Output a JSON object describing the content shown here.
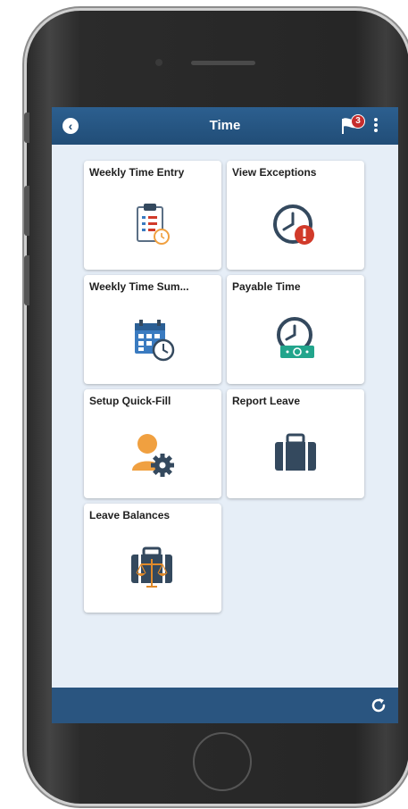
{
  "header": {
    "title": "Time",
    "notification_count": "3"
  },
  "tiles": [
    {
      "label": "Weekly Time Entry",
      "icon": "clipboard-clock-icon"
    },
    {
      "label": "View Exceptions",
      "icon": "clock-alert-icon"
    },
    {
      "label": "Weekly Time Sum...",
      "icon": "calendar-clock-icon"
    },
    {
      "label": "Payable Time",
      "icon": "clock-money-icon"
    },
    {
      "label": "Setup Quick-Fill",
      "icon": "user-gear-icon"
    },
    {
      "label": "Report Leave",
      "icon": "briefcase-icon"
    },
    {
      "label": "Leave Balances",
      "icon": "briefcase-scale-icon"
    }
  ],
  "colors": {
    "header_bg": "#214d77",
    "screen_bg": "#e6eef7",
    "icon_navy": "#34495e",
    "icon_blue": "#3a7bc0",
    "icon_orange": "#f0a040",
    "alert_red": "#d13a2a",
    "money_green": "#22a58c"
  }
}
